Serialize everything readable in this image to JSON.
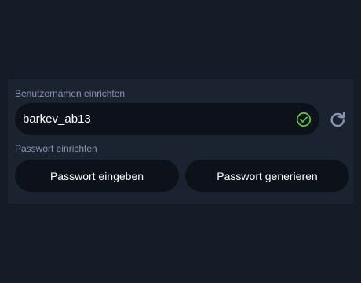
{
  "username": {
    "label": "Benutzernamen einrichten",
    "value": "barkev_ab13",
    "status": "valid",
    "status_icon": "check-circle-icon",
    "status_color": "#5ec24a",
    "refresh_icon": "refresh-icon"
  },
  "password": {
    "label": "Passwort einrichten",
    "enter_button": "Passwort eingeben",
    "generate_button": "Passwort generieren"
  },
  "colors": {
    "background": "#161c27",
    "panel": "#1b2230",
    "field": "#0c111a",
    "label": "#8b97b0",
    "icon": "#8b97b0"
  }
}
